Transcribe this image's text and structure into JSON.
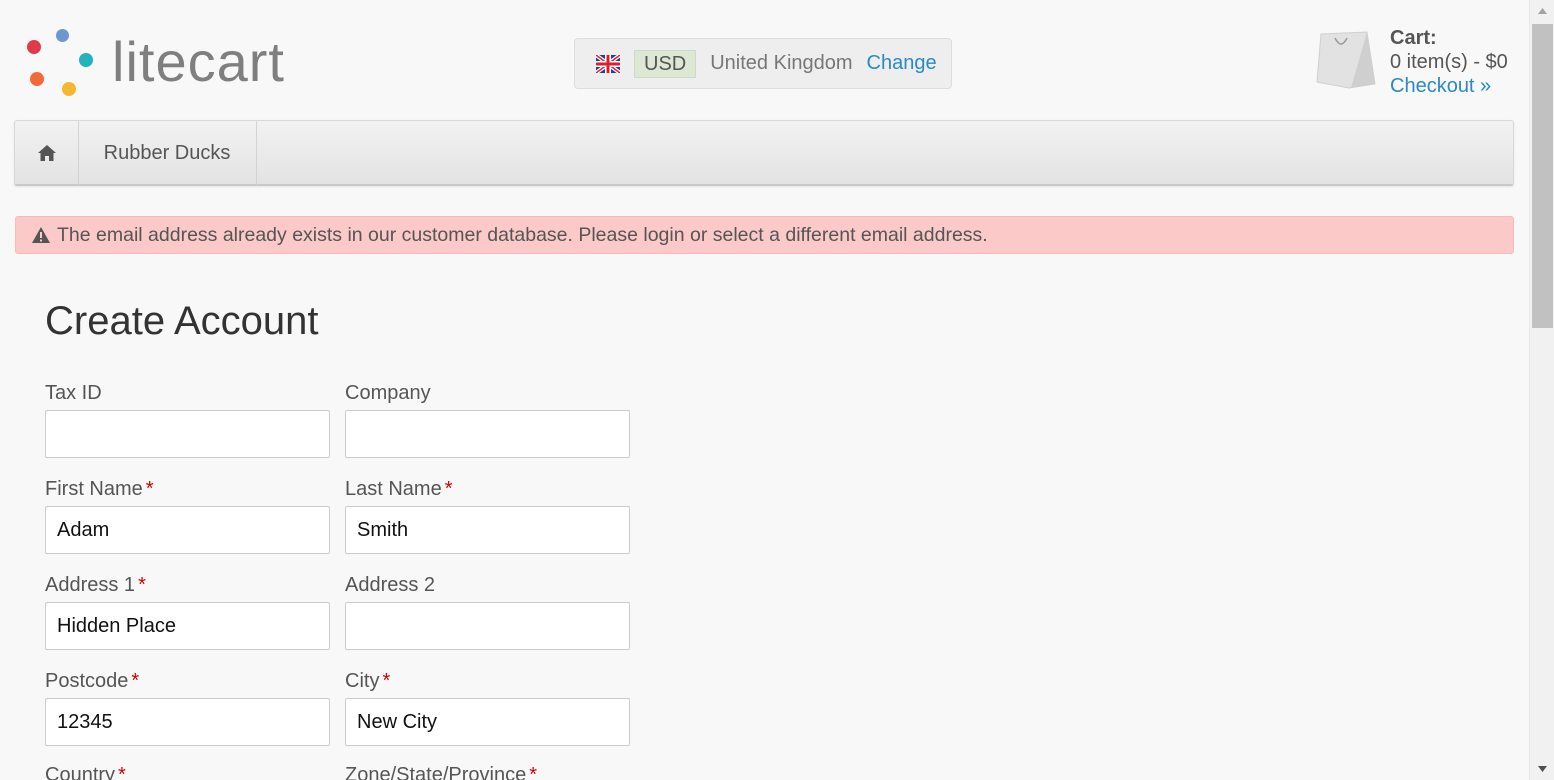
{
  "logo": {
    "text": "litecart",
    "dot_colors": [
      "#6f97cf",
      "#e03b4a",
      "#24b3b8",
      "#f26a3a",
      "#f5b731"
    ]
  },
  "region": {
    "currency": "USD",
    "country": "United Kingdom",
    "change_label": "Change"
  },
  "cart": {
    "title": "Cart:",
    "count_text": "0 item(s) - $0",
    "checkout_label": "Checkout »"
  },
  "nav": {
    "home_icon": "home-icon",
    "items": [
      {
        "label": "Rubber Ducks"
      }
    ]
  },
  "alert": {
    "icon": "warning-icon",
    "message": "The email address already exists in our customer database. Please login or select a different email address."
  },
  "form": {
    "title": "Create Account",
    "required_mark": "*",
    "fields": {
      "tax_id": {
        "label": "Tax ID",
        "value": ""
      },
      "company": {
        "label": "Company",
        "value": ""
      },
      "first_name": {
        "label": "First Name",
        "value": "Adam"
      },
      "last_name": {
        "label": "Last Name",
        "value": "Smith"
      },
      "address1": {
        "label": "Address 1",
        "value": "Hidden Place"
      },
      "address2": {
        "label": "Address 2",
        "value": ""
      },
      "postcode": {
        "label": "Postcode",
        "value": "12345"
      },
      "city": {
        "label": "City",
        "value": "New City"
      },
      "country": {
        "label": "Country"
      },
      "zone": {
        "label": "Zone/State/Province"
      }
    }
  },
  "colors": {
    "link": "#2a8ac5",
    "alert_bg": "#fcc9c9",
    "required": "#d20000"
  }
}
